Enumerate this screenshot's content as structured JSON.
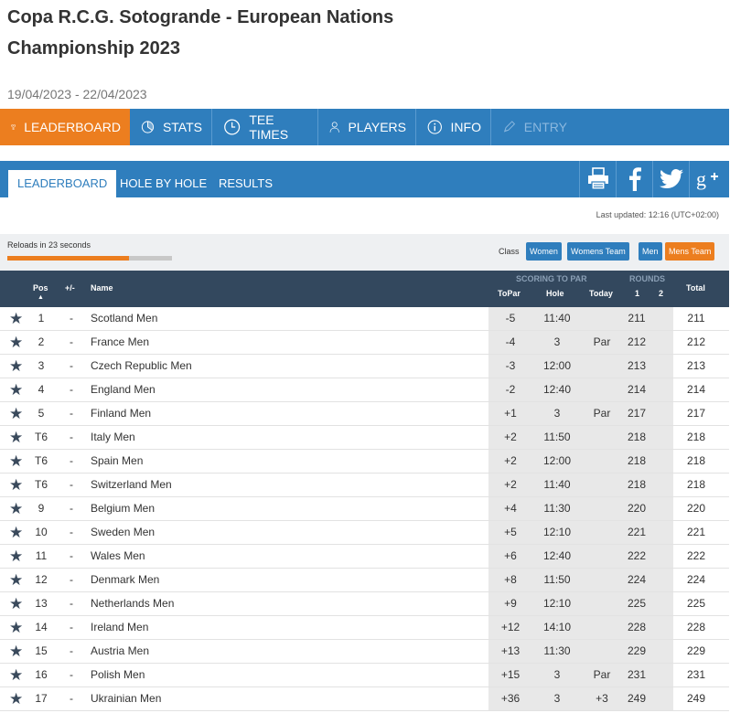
{
  "title": "Copa R.C.G. Sotogrande - European Nations Championship 2023",
  "dates": "19/04/2023 - 22/04/2023",
  "mainnav": [
    {
      "label": "LEADERBOARD",
      "icon": "trophy-icon"
    },
    {
      "label": "STATS",
      "icon": "pie-chart-icon"
    },
    {
      "label": "TEE TIMES",
      "icon": "clock-icon"
    },
    {
      "label": "PLAYERS",
      "icon": "person-icon"
    },
    {
      "label": "INFO",
      "icon": "info-icon"
    },
    {
      "label": "ENTRY",
      "icon": "pen-icon"
    }
  ],
  "subnav": {
    "tabs": [
      "LEADERBOARD",
      "HOLE BY HOLE",
      "RESULTS"
    ],
    "share_icons": [
      "print-icon",
      "facebook-icon",
      "twitter-icon",
      "google-plus-icon"
    ]
  },
  "last_updated": "Last updated: 12:16 (UTC+02:00)",
  "reload": {
    "text": "Reloads in 23 seconds",
    "progress": 0.74
  },
  "class_filter": {
    "label": "Class",
    "options": [
      "Women",
      "Womens Team",
      "Men",
      "Mens Team"
    ],
    "selected": "Mens Team"
  },
  "accent_colors": {
    "blue": "#2f7ebd",
    "orange": "#ec7e1f",
    "header": "#33485e"
  },
  "table": {
    "headers": {
      "pos": "Pos",
      "change": "+/-",
      "name": "Name",
      "scoring_group": "SCORING TO PAR",
      "topar": "ToPar",
      "hole": "Hole",
      "today": "Today",
      "rounds_group": "ROUNDS",
      "r1": "1",
      "r2": "2",
      "total": "Total"
    },
    "rows": [
      {
        "pos": "1",
        "change": "-",
        "name": "Scotland Men",
        "topar": "-5",
        "hole": "11:40",
        "today": "",
        "r1": "211",
        "r2": "",
        "total": "211"
      },
      {
        "pos": "2",
        "change": "-",
        "name": "France Men",
        "topar": "-4",
        "hole": "3",
        "today": "Par",
        "r1": "212",
        "r2": "",
        "total": "212"
      },
      {
        "pos": "3",
        "change": "-",
        "name": "Czech Republic Men",
        "topar": "-3",
        "hole": "12:00",
        "today": "",
        "r1": "213",
        "r2": "",
        "total": "213"
      },
      {
        "pos": "4",
        "change": "-",
        "name": "England Men",
        "topar": "-2",
        "hole": "12:40",
        "today": "",
        "r1": "214",
        "r2": "",
        "total": "214"
      },
      {
        "pos": "5",
        "change": "-",
        "name": "Finland Men",
        "topar": "+1",
        "hole": "3",
        "today": "Par",
        "r1": "217",
        "r2": "",
        "total": "217"
      },
      {
        "pos": "T6",
        "change": "-",
        "name": "Italy Men",
        "topar": "+2",
        "hole": "11:50",
        "today": "",
        "r1": "218",
        "r2": "",
        "total": "218"
      },
      {
        "pos": "T6",
        "change": "-",
        "name": "Spain Men",
        "topar": "+2",
        "hole": "12:00",
        "today": "",
        "r1": "218",
        "r2": "",
        "total": "218"
      },
      {
        "pos": "T6",
        "change": "-",
        "name": "Switzerland Men",
        "topar": "+2",
        "hole": "11:40",
        "today": "",
        "r1": "218",
        "r2": "",
        "total": "218"
      },
      {
        "pos": "9",
        "change": "-",
        "name": "Belgium Men",
        "topar": "+4",
        "hole": "11:30",
        "today": "",
        "r1": "220",
        "r2": "",
        "total": "220"
      },
      {
        "pos": "10",
        "change": "-",
        "name": "Sweden Men",
        "topar": "+5",
        "hole": "12:10",
        "today": "",
        "r1": "221",
        "r2": "",
        "total": "221"
      },
      {
        "pos": "11",
        "change": "-",
        "name": "Wales Men",
        "topar": "+6",
        "hole": "12:40",
        "today": "",
        "r1": "222",
        "r2": "",
        "total": "222"
      },
      {
        "pos": "12",
        "change": "-",
        "name": "Denmark Men",
        "topar": "+8",
        "hole": "11:50",
        "today": "",
        "r1": "224",
        "r2": "",
        "total": "224"
      },
      {
        "pos": "13",
        "change": "-",
        "name": "Netherlands Men",
        "topar": "+9",
        "hole": "12:10",
        "today": "",
        "r1": "225",
        "r2": "",
        "total": "225"
      },
      {
        "pos": "14",
        "change": "-",
        "name": "Ireland Men",
        "topar": "+12",
        "hole": "14:10",
        "today": "",
        "r1": "228",
        "r2": "",
        "total": "228"
      },
      {
        "pos": "15",
        "change": "-",
        "name": "Austria Men",
        "topar": "+13",
        "hole": "11:30",
        "today": "",
        "r1": "229",
        "r2": "",
        "total": "229"
      },
      {
        "pos": "16",
        "change": "-",
        "name": "Polish Men",
        "topar": "+15",
        "hole": "3",
        "today": "Par",
        "r1": "231",
        "r2": "",
        "total": "231"
      },
      {
        "pos": "17",
        "change": "-",
        "name": "Ukrainian Men",
        "topar": "+36",
        "hole": "3",
        "today": "+3",
        "r1": "249",
        "r2": "",
        "total": "249"
      }
    ]
  }
}
